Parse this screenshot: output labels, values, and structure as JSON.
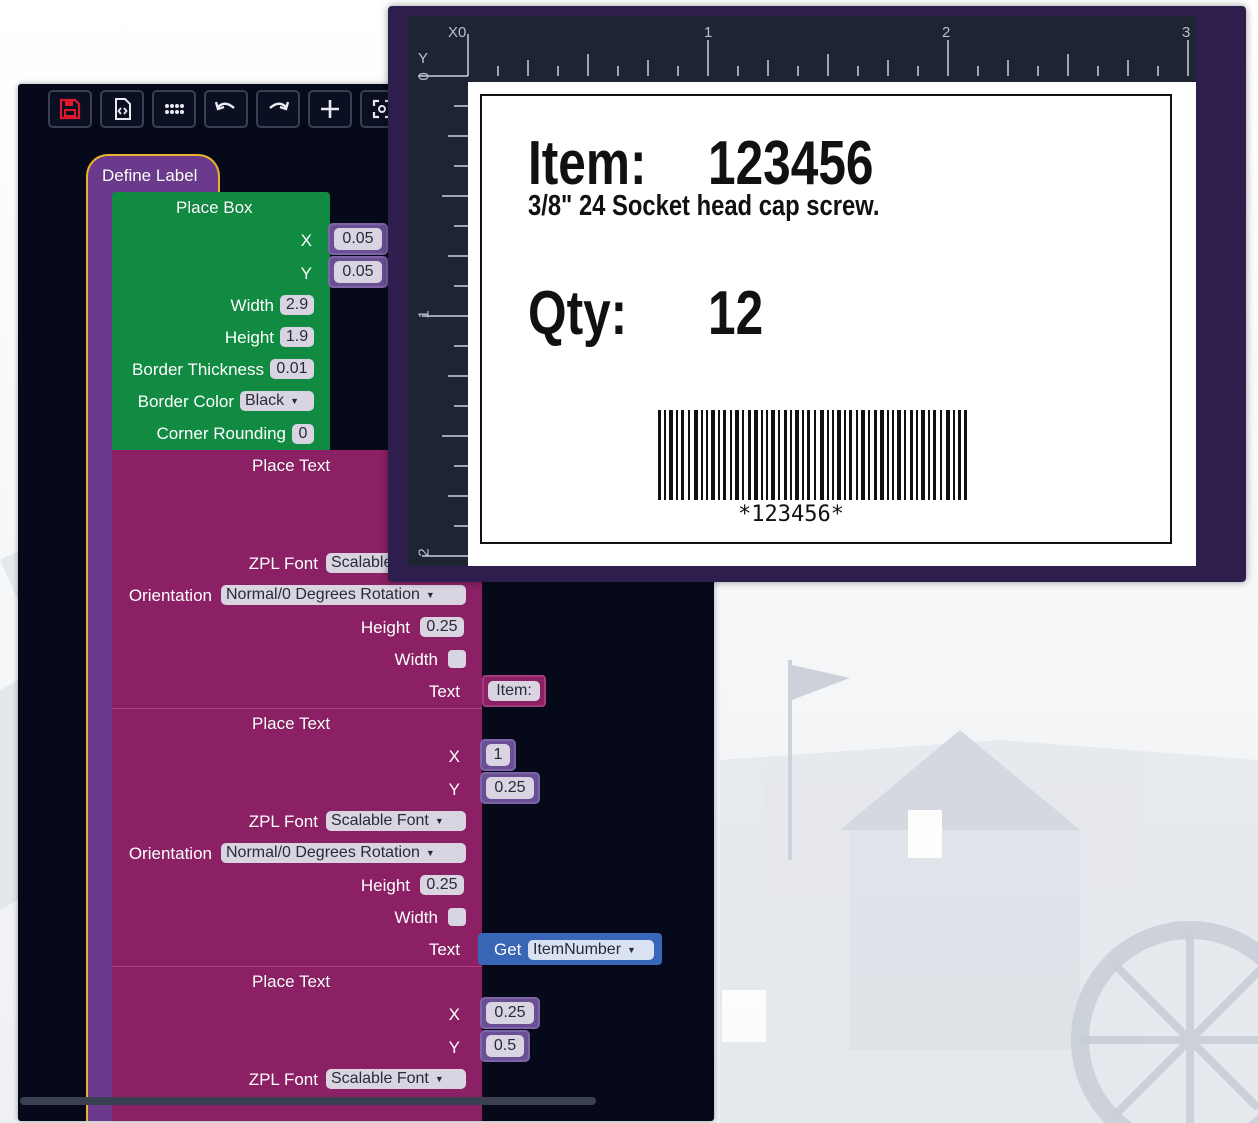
{
  "editor": {
    "toolbar": [
      {
        "name": "save-icon",
        "color": "#e0182d"
      },
      {
        "name": "export-code-icon"
      },
      {
        "name": "grid-dots-icon"
      },
      {
        "name": "undo-icon"
      },
      {
        "name": "redo-icon"
      },
      {
        "name": "add-icon"
      },
      {
        "name": "zoom-icon"
      }
    ],
    "define_label": {
      "title": "Define Label",
      "color": "#6b3a8c",
      "outline": "#e7b52b"
    },
    "place_box": {
      "title": "Place Box",
      "color": "#118a42",
      "x_label": "X",
      "x_value": "0.05",
      "y_label": "Y",
      "y_value": "0.05",
      "width_label": "Width",
      "width_value": "2.9",
      "height_label": "Height",
      "height_value": "1.9",
      "border_thickness_label": "Border Thickness",
      "border_thickness_value": "0.01",
      "border_color_label": "Border Color",
      "border_color_value": "Black",
      "corner_rounding_label": "Corner Rounding",
      "corner_rounding_value": "0"
    },
    "place_text_1": {
      "title": "Place Text",
      "color": "#8b2065",
      "zpl_font_label": "ZPL Font",
      "zpl_font_value": "Scalable Font",
      "orientation_label": "Orientation",
      "orientation_value": "Normal/0 Degrees Rotation",
      "height_label": "Height",
      "height_value": "0.25",
      "width_label": "Width",
      "text_label": "Text",
      "text_value": "Item:"
    },
    "place_text_2": {
      "title": "Place Text",
      "x_label": "X",
      "x_value": "1",
      "y_label": "Y",
      "y_value": "0.25",
      "zpl_font_label": "ZPL Font",
      "zpl_font_value": "Scalable Font",
      "orientation_label": "Orientation",
      "orientation_value": "Normal/0 Degrees Rotation",
      "height_label": "Height",
      "height_value": "0.25",
      "width_label": "Width",
      "text_label": "Text",
      "get_label": "Get",
      "get_variable": "ItemNumber",
      "get_color": "#3a66b8"
    },
    "place_text_3": {
      "title": "Place Text",
      "x_label": "X",
      "x_value": "0.25",
      "y_label": "Y",
      "y_value": "0.5",
      "zpl_font_label": "ZPL Font",
      "zpl_font_value": "Scalable Font"
    }
  },
  "preview": {
    "ruler_top_labels": [
      "X0",
      "1",
      "2",
      "3"
    ],
    "ruler_left_labels": [
      "Y",
      "0",
      "1",
      "2"
    ],
    "label": {
      "item_label": "Item:",
      "item_number": "123456",
      "description": "3/8\" 24 Socket head cap screw.",
      "qty_label": "Qty:",
      "qty_value": "12",
      "barcode_text": "*123456*"
    }
  }
}
